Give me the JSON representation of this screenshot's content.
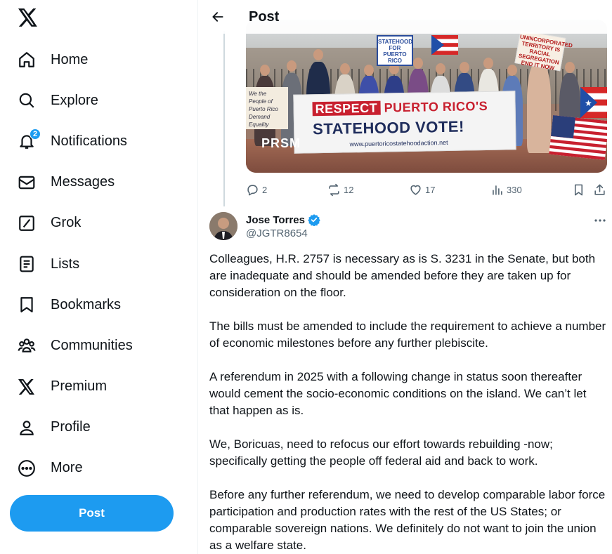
{
  "sidebar": {
    "logo": "x-logo-icon",
    "items": [
      {
        "label": "Home",
        "icon": "home-icon"
      },
      {
        "label": "Explore",
        "icon": "search-icon"
      },
      {
        "label": "Notifications",
        "icon": "bell-icon",
        "badge": "2"
      },
      {
        "label": "Messages",
        "icon": "envelope-icon"
      },
      {
        "label": "Grok",
        "icon": "grok-icon"
      },
      {
        "label": "Lists",
        "icon": "list-icon"
      },
      {
        "label": "Bookmarks",
        "icon": "bookmark-icon"
      },
      {
        "label": "Communities",
        "icon": "people-icon"
      },
      {
        "label": "Premium",
        "icon": "x-premium-icon"
      },
      {
        "label": "Profile",
        "icon": "person-icon"
      },
      {
        "label": "More",
        "icon": "more-circle-icon"
      }
    ],
    "post_button": "Post"
  },
  "header": {
    "title": "Post"
  },
  "image": {
    "banner_line1_highlight": "RESPECT",
    "banner_line1_rest": "PUERTO RICO'S",
    "banner_line2": "STATEHOOD VOTE!",
    "banner_url": "www.puertoricostatehoodaction.net",
    "sign_statehood": "STATEHOOD FOR PUERTO RICO",
    "sign_right": "UNINCORPORATED TERRITORY IS RACIAL SEGREGATION END IT NOW",
    "sign_left": "We the People of Puerto Rico Demand Equality",
    "watermark": "PRSM"
  },
  "actions": {
    "replies": "2",
    "reposts": "12",
    "likes": "17",
    "views": "330"
  },
  "reply": {
    "name": "Jose Torres",
    "handle": "@JGTR8654",
    "paragraphs": [
      "Colleagues, H.R. 2757 is necessary as is S. 3231 in the Senate, but both are inadequate and should be amended before they are taken up for consideration on the floor.",
      "The bills must be amended to include the requirement to achieve a number of economic milestones before any further plebiscite.",
      "A referendum in 2025 with a following change in status soon thereafter would cement the socio-economic conditions on the island. We can’t let that happen as is.",
      "We, Boricuas, need to refocus our effort towards rebuilding -now; specifically getting the people off federal aid and back to work.",
      "Before any further referendum, we need to develop comparable labor force participation and production rates with the rest of the US States; or comparable sovereign nations. We definitely do not want to join the union as a welfare state."
    ]
  },
  "colors": {
    "accent": "#1d9bf0",
    "text": "#0f1419",
    "muted": "#536471"
  }
}
